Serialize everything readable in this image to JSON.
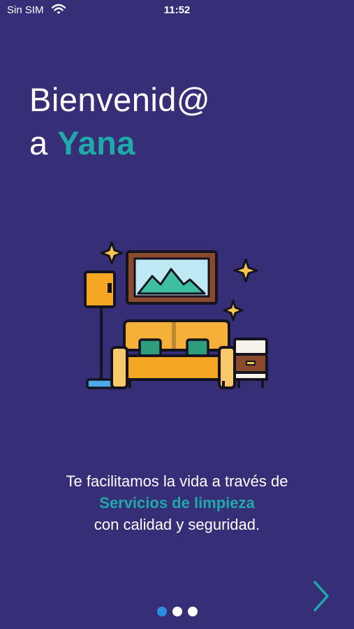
{
  "status_bar": {
    "carrier": "Sin SIM",
    "time": "11:52"
  },
  "welcome": {
    "line1": "Bienvenid@",
    "line2_prefix": "a",
    "brand": "Yana"
  },
  "illustration": {
    "icon": "living-room-icon"
  },
  "tagline": {
    "line1": "Te facilitamos la vida a través de",
    "highlight": "Servicios de limpieza",
    "line3": "con calidad y seguridad."
  },
  "pager": {
    "count": 3,
    "active_index": 0
  },
  "navigation": {
    "next_icon": "chevron-right-icon"
  },
  "colors": {
    "background": "#372e78",
    "accent": "#1fa9a8",
    "active_dot": "#2b8fe0"
  }
}
